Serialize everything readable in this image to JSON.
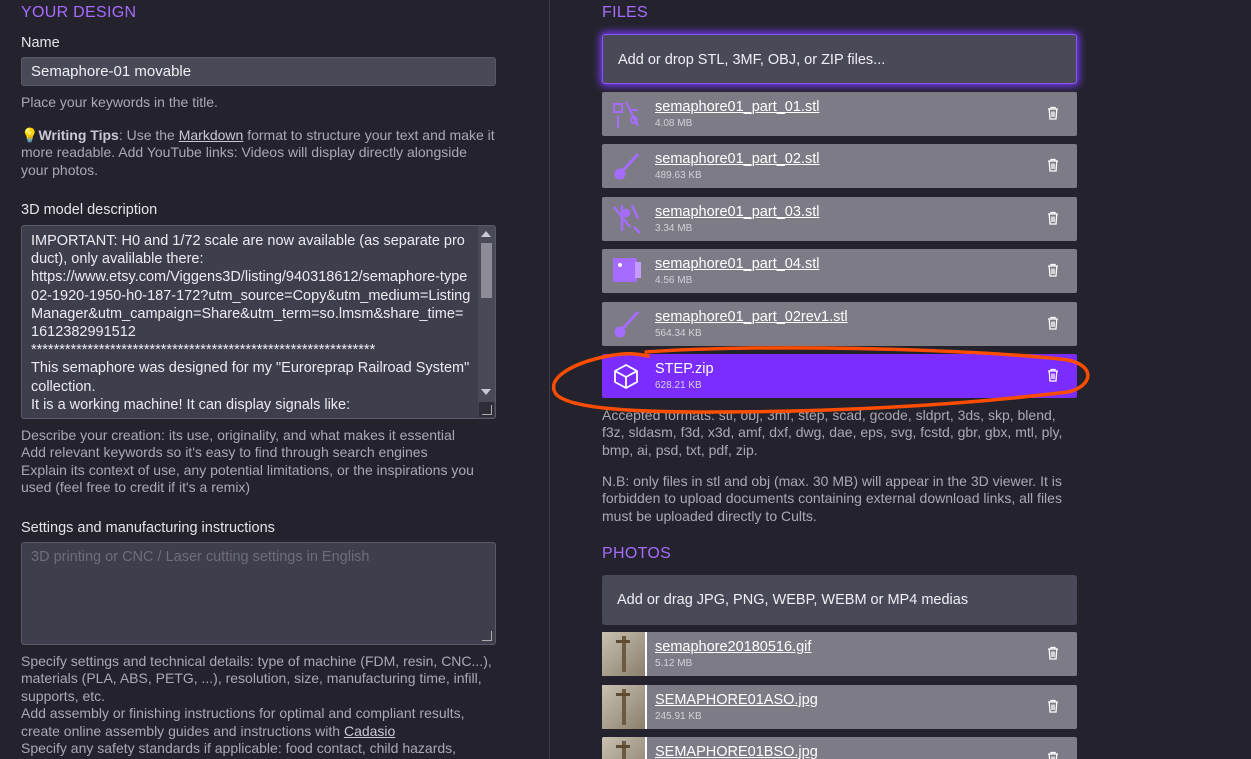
{
  "left": {
    "section_title": "YOUR DESIGN",
    "name_label": "Name",
    "name_value": "Semaphore-01 movable",
    "name_help": "Place your keywords in the title.",
    "tips_bold": "Writing Tips",
    "tips_pre": ": Use the ",
    "tips_link": "Markdown",
    "tips_post": " format to structure your text and make it more readable. Add YouTube links: Videos will display directly alongside your photos.",
    "description_label": "3D model description",
    "description_value": "IMPORTANT: H0 and 1/72 scale are now available (as separate product), only avalilable there:\nhttps://www.etsy.com/Viggens3D/listing/940318612/semaphore-type02-1920-1950-h0-187-172?utm_source=Copy&utm_medium=ListingManager&utm_campaign=Share&utm_term=so.lmsm&share_time=1612382991512\n*************************************************************\nThis semaphore was designed for my \"Euroreprap Railroad System\" collection.\nIt is a working machine! It can display signals like:",
    "description_help": "Describe your creation: its use, originality, and what makes it essential\nAdd relevant keywords so it's easy to find through search engines\nExplain its context of use, any potential limitations, or the inspirations you used (feel free to credit if it's a remix)",
    "settings_label": "Settings and manufacturing instructions",
    "settings_placeholder": "3D printing or CNC / Laser cutting settings in English",
    "settings_help_1": "Specify settings and technical details: type of machine (FDM, resin, CNC...), materials (PLA, ABS, PETG, ...), resolution, size, manufacturing time, infill, supports, etc.",
    "settings_help_2_pre": "Add assembly or finishing instructions for optimal and compliant results, create online assembly guides and instructions with ",
    "settings_help_2_link": "Cadasio",
    "settings_help_3": "Specify any safety standards if applicable: food contact, child hazards,"
  },
  "files": {
    "section_title": "FILES",
    "dropzone": "Add or drop STL, 3MF, OBJ, or ZIP files...",
    "items": [
      {
        "name": "semaphore01_part_01.stl",
        "size": "4.08 MB"
      },
      {
        "name": "semaphore01_part_02.stl",
        "size": "489.63 KB"
      },
      {
        "name": "semaphore01_part_03.stl",
        "size": "3.34 MB"
      },
      {
        "name": "semaphore01_part_04.stl",
        "size": "4.56 MB"
      },
      {
        "name": "semaphore01_part_02rev1.stl",
        "size": "564.34 KB"
      },
      {
        "name": "STEP.zip",
        "size": "628.21 KB"
      }
    ],
    "accepted": "Accepted formats: stl, obj, 3mf, step, scad, gcode, sldprt, 3ds, skp, blend, f3z, sldasm, f3d, x3d, amf, dxf, dwg, dae, eps, svg, fcstd, gbr, gbx, mtl, ply, bmp, ai, psd, txt, pdf, zip.",
    "nb": "N.B: only files in stl and obj (max. 30 MB) will appear in the 3D viewer. It is forbidden to upload documents containing external download links, all files must be uploaded directly to Cults."
  },
  "photos": {
    "section_title": "PHOTOS",
    "dropzone": "Add or drag JPG, PNG, WEBP, WEBM or MP4 medias",
    "items": [
      {
        "name": "semaphore20180516.gif",
        "size": "5.12 MB"
      },
      {
        "name": "SEMAPHORE01ASO.jpg",
        "size": "245.91 KB"
      },
      {
        "name": "SEMAPHORE01BSO.jpg",
        "size": ""
      }
    ]
  },
  "colors": {
    "accent": "#a66cff",
    "active_row": "#7b2cff",
    "annotation": "#ff4d00"
  }
}
